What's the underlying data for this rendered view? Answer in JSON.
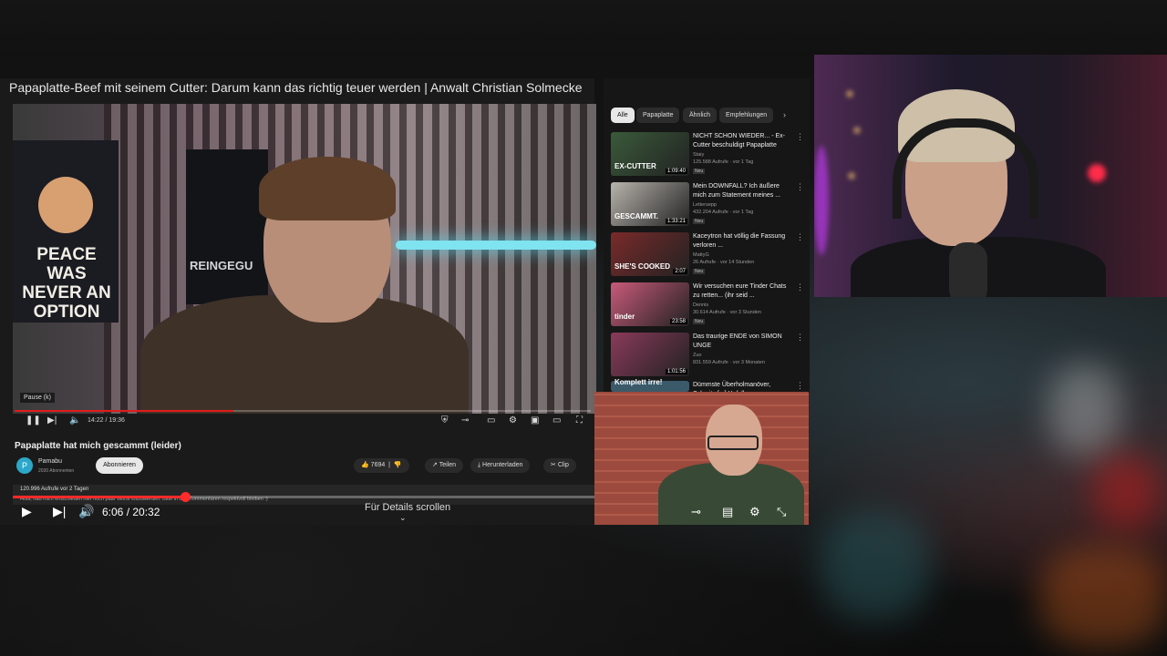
{
  "video": {
    "title": "Papaplatte-Beef mit seinem Cutter: Darum kann das richtig teuer werden | Anwalt Christian Solmecke",
    "time_label": "6:06 / 20:32",
    "progress": 0.297,
    "scroll_hint": "Für Details scrollen"
  },
  "inner": {
    "poster_text": "PEACE WAS NEVER AN OPTION",
    "poster2_text": "REINGEGU",
    "pause_tooltip": "Pause (k)",
    "time_label": "14:22 / 19:36",
    "progress": 0.38,
    "video_title": "Papaplatte hat mich gescammt (leider)",
    "channel_name": "Pamabu",
    "channel_initial": "P",
    "channel_subs": "2030 Abonnenten",
    "subscribe_label": "Abonnieren",
    "likes": "7694",
    "share_label": "Teilen",
    "download_label": "Herunterladen",
    "clip_label": "Clip",
    "views_line": "120.996 Aufrufe  vor 2 Tagen",
    "description": "Hola, hab mich entschieden hier noch paar Worte loszuwerden. Bitte in den Kommentaren respektvoll bleiben :)"
  },
  "sidebar": {
    "chips": [
      "Alle",
      "Papaplatte",
      "Ähnlich",
      "Empfehlungen"
    ],
    "items": [
      {
        "title": "NICHT SCHON WIEDER... - Ex-Cutter beschuldigt Papaplatte",
        "channel": "Staiy",
        "meta": "125.588 Aufrufe · vor 1 Tag",
        "badge": "Neu",
        "duration": "1:09:40",
        "thumb_label": "EX-CUTTER",
        "color": "#3a5a3a"
      },
      {
        "title": "Mein DOWNFALL? Ich äußere mich zum Statement meines ...",
        "channel": "Lettersepp",
        "meta": "432.204 Aufrufe · vor 1 Tag",
        "badge": "Neu",
        "duration": "1:33:21",
        "thumb_label": "GESCAMMT.",
        "color": "#b8b4ad"
      },
      {
        "title": "Kaceytron hat völlig die Fassung verloren ...",
        "channel": "MattyG",
        "meta": "26 Aufrufe · vor 14 Stunden",
        "badge": "Neu",
        "duration": "2:07",
        "thumb_label": "SHE'S COOKED",
        "color": "#7a2a2a"
      },
      {
        "title": "Wir versuchen eure Tinder Chats zu retten... (ihr seid ...",
        "channel": "Dennis",
        "meta": "30.614 Aufrufe · vor 3 Stunden",
        "badge": "Neu",
        "duration": "23:58",
        "thumb_label": "tinder",
        "color": "#c85a7a"
      },
      {
        "title": "Das traurige ENDE von SIMON UNGE",
        "channel": "Zuo",
        "meta": "831.559 Aufrufe · vor 3 Monaten",
        "badge": "",
        "duration": "1:01:56",
        "thumb_label": "",
        "color": "#8a3a5a"
      },
      {
        "title": "Dümmste Überholmanöver, Schmitz [...] Unfall",
        "channel": "",
        "meta": "",
        "badge": "",
        "duration": "",
        "thumb_label": "Komplett irre!",
        "color": "#3a5a6a"
      }
    ]
  },
  "colors": {
    "accent_red": "#ff2a2a",
    "panel_bg": "#1a1a1a",
    "sidebar_bg": "#161616"
  }
}
